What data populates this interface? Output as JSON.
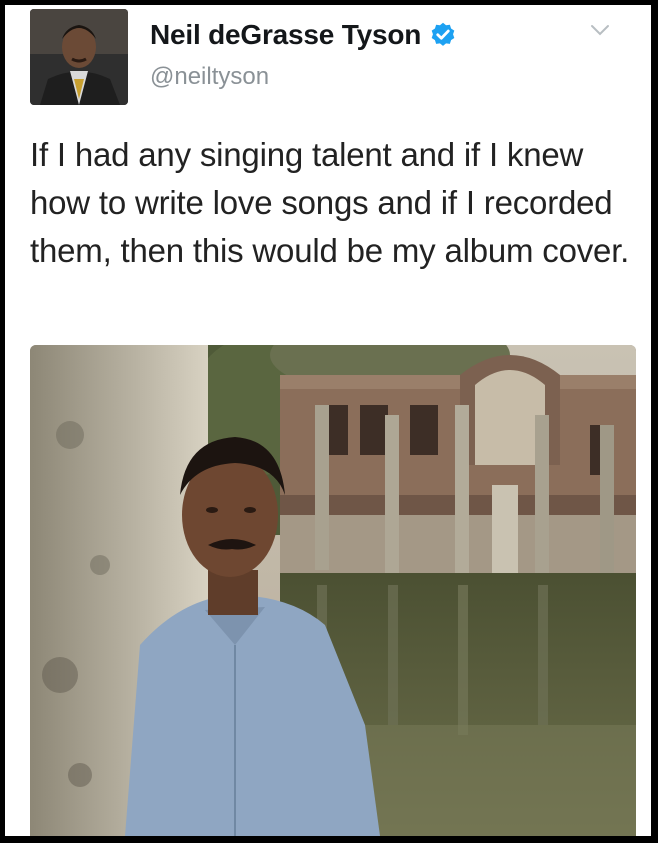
{
  "tweet": {
    "author_name": "Neil deGrasse Tyson",
    "handle": "@neiltyson",
    "verified": true,
    "text": "If I had any singing talent and if I knew how to write love songs and if I recorded them, then this would be my album cover."
  },
  "icons": {
    "verified": "verified-badge-icon",
    "menu": "chevron-down-icon"
  },
  "colors": {
    "verified_blue": "#1da1f2",
    "name_text": "#14171a",
    "handle_text": "#8a9196",
    "frame": "#000000"
  }
}
